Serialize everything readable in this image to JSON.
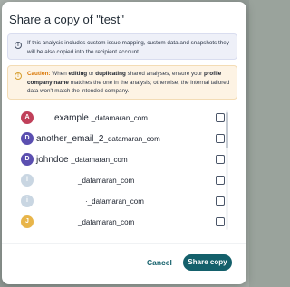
{
  "dialog": {
    "title": "Share a copy of \"test\"",
    "info_notice": "If this analysis includes custom issue mapping, custom data and snapshots they will be also copied into the recipient account.",
    "info_icon": "info-icon",
    "warning": {
      "label": "Caution:",
      "text_1": " When ",
      "bold_1": "editing",
      "text_2": " or ",
      "bold_2": "duplicating",
      "text_3": " shared analyses, ensure your ",
      "bold_3": "profile company name",
      "text_4": " matches the one in the analysis; otherwise, the internal tailored data won't match the intended company."
    },
    "warning_icon": "warning-icon",
    "recipients": [
      {
        "initial": "A",
        "user": "example",
        "domain": "_datamaran_com",
        "avatar_color": "#c0405a"
      },
      {
        "initial": "D",
        "user": "another_email_2",
        "domain": "_datamaran_com",
        "avatar_color": "#5b4fb0"
      },
      {
        "initial": "D",
        "user": "johndoe",
        "domain": "_datamaran_com",
        "avatar_color": "#5b4fb0"
      },
      {
        "initial": "i",
        "user": "",
        "domain": "_datamaran_com",
        "avatar_color": "#c9d6e2"
      },
      {
        "initial": "i",
        "user": "",
        "domain": "·_datamaran_com",
        "avatar_color": "#c9d6e2"
      },
      {
        "initial": "J",
        "user": "",
        "domain": "_datamaran_com",
        "avatar_color": "#e8b54a"
      }
    ],
    "cancel_label": "Cancel",
    "share_label": "Share copy"
  }
}
